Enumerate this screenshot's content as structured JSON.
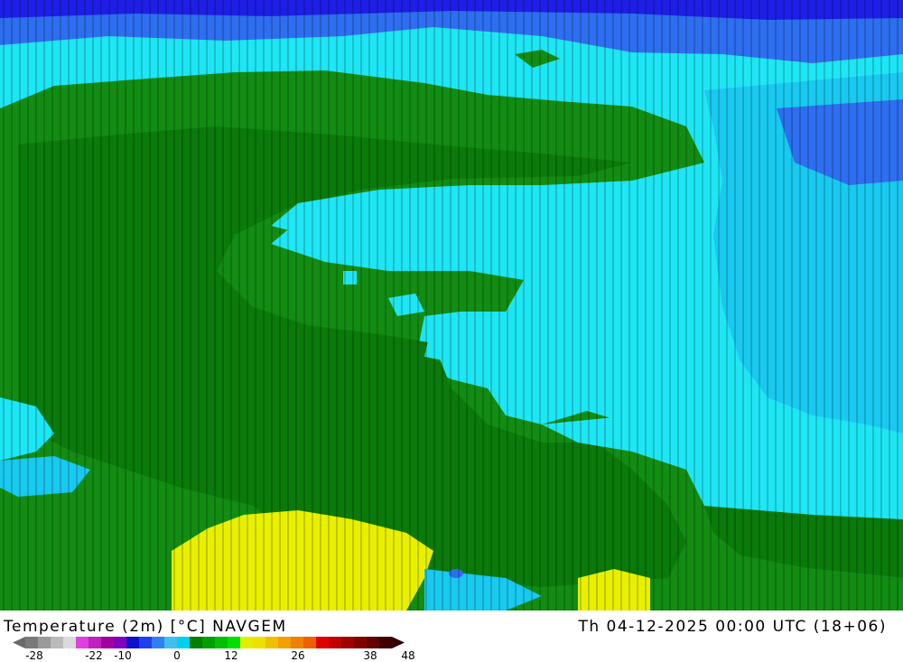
{
  "map": {
    "title": "Temperature (2m) [°C] NAVGEM",
    "valid_time": "Th 04-12-2025 00:00 UTC (18+06)",
    "region_colors": {
      "very_cold": "#1e1ee6",
      "cold": "#2e6ef0",
      "cool": "#19c9f0",
      "cyan": "#1ee6f5",
      "green_dark": "#0a7a0a",
      "green": "#128c12",
      "green_light": "#18a818",
      "yellow": "#f0f000",
      "sea_green": "#0f9a5a"
    }
  },
  "legend": {
    "tick_labels": [
      "-28",
      "-22",
      "-10",
      "0",
      "12",
      "26",
      "38",
      "48"
    ],
    "colors": [
      "#7a7a7a",
      "#9a9a9a",
      "#bababa",
      "#dadada",
      "#e040e0",
      "#c020c0",
      "#a000a0",
      "#8000c0",
      "#1010d0",
      "#2040f0",
      "#3080f0",
      "#40c0f0",
      "#00d0f0",
      "#008000",
      "#00a000",
      "#00c000",
      "#00e000",
      "#e0f000",
      "#f0e000",
      "#f0c000",
      "#f0a000",
      "#f08000",
      "#f06000",
      "#e00000",
      "#c00000",
      "#a00000",
      "#800000",
      "#600000",
      "#400000"
    ]
  }
}
